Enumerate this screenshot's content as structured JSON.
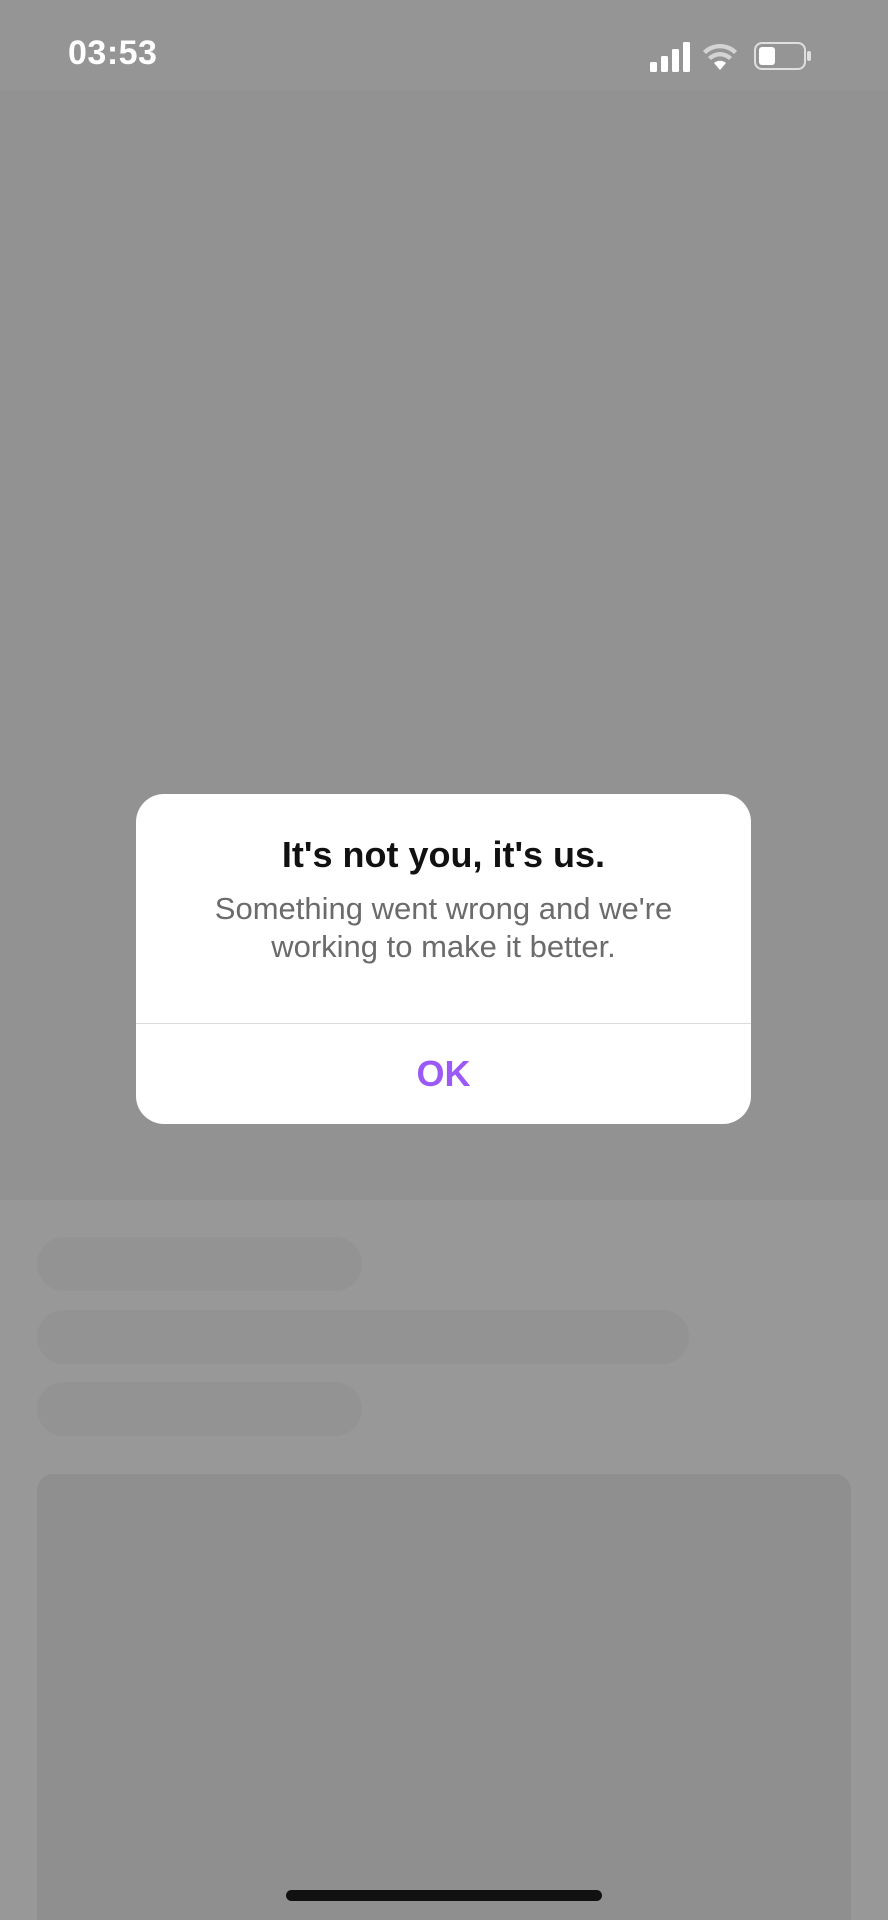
{
  "status_bar": {
    "time": "03:53",
    "icons": [
      "cellular-signal-icon",
      "wifi-icon",
      "battery-icon"
    ]
  },
  "alert": {
    "title": "It's not you, it's us.",
    "message": "Something went wrong and we're working to make it better.",
    "ok_label": "OK"
  },
  "colors": {
    "accent": "#9b59f5",
    "overlay": "#969696",
    "dialog_bg": "#ffffff"
  }
}
